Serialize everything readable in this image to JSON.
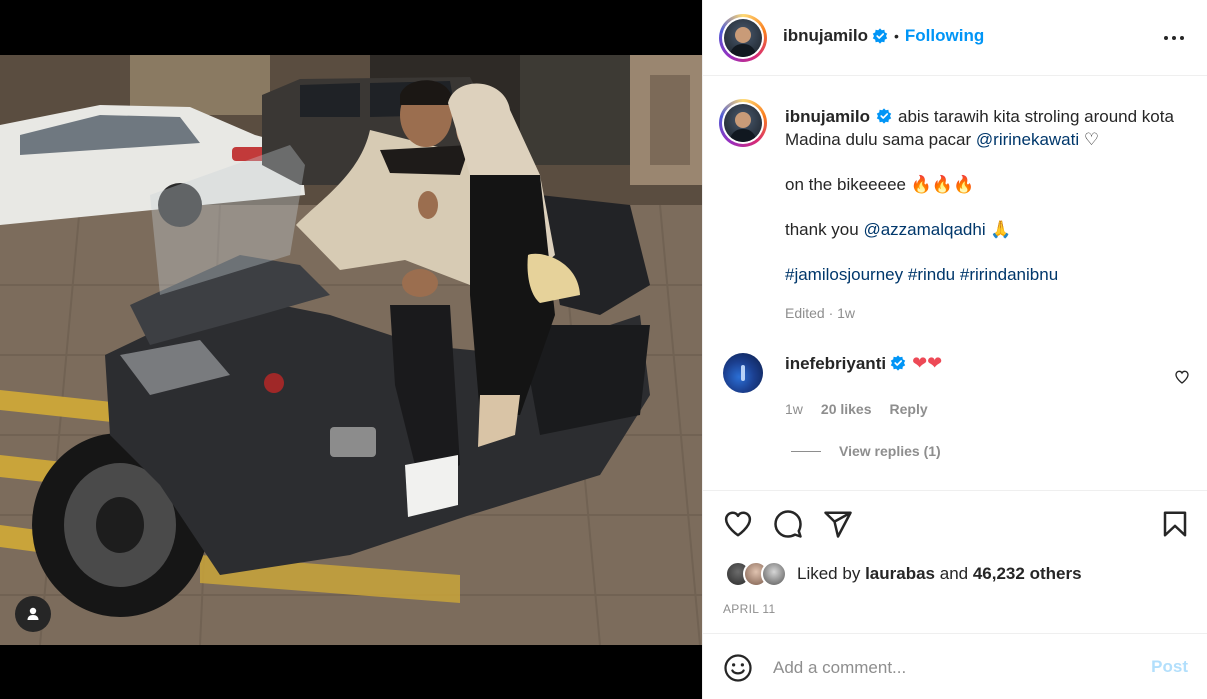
{
  "post": {
    "username": "ibnujamilo",
    "follow_status": "Following",
    "caption_line1": "abis tarawih kita stroling around kota Madina dulu sama pacar",
    "caption_mention1": "@ririnekawati",
    "caption_heart": "♡",
    "caption_para2": "on the bikeeeee",
    "fire_emoji": "🔥🔥🔥",
    "caption_para3": "thank you",
    "caption_mention2": "@azzamalqadhi",
    "pray_emoji": "🙏",
    "hashtags": [
      "#jamilosjourney",
      "#rindu",
      "#ririndanibnu"
    ],
    "edited_meta": "Edited · 1w",
    "date": "APRIL 11"
  },
  "comment": {
    "username": "inefebriyanti",
    "text": "❤❤",
    "time": "1w",
    "likes": "20 likes",
    "reply_label": "Reply",
    "view_replies": "View replies (1)"
  },
  "likes": {
    "prefix": "Liked by",
    "user": "laurabas",
    "middle": "and",
    "others": "46,232 others"
  },
  "add_comment": {
    "placeholder": "Add a comment...",
    "post_label": "Post"
  },
  "colors": {
    "accent": "#0095f6",
    "link": "#00376b",
    "muted": "#8e8e8e",
    "heart_red": "#ed4956",
    "post_disabled": "#b2dffc"
  }
}
